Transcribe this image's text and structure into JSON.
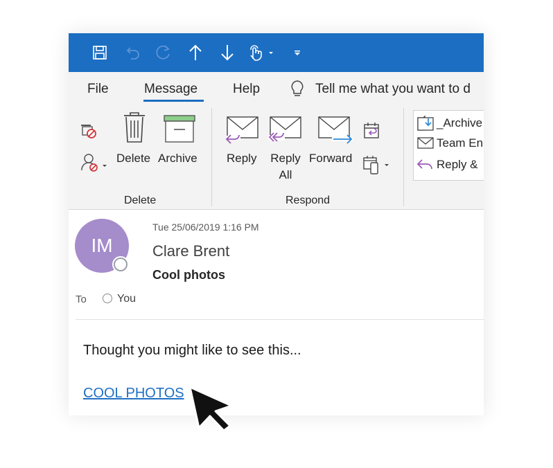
{
  "colors": {
    "titlebar": "#1b6ec2",
    "ribbon": "#f3f3f3",
    "avatar": "#a58ccb",
    "link": "#1f6fc5",
    "accent_purple": "#9b59b6"
  },
  "quick_access": [
    "save-icon",
    "undo-icon",
    "redo-icon",
    "previous-item-icon",
    "next-item-icon",
    "touch-mode-icon",
    "customize-qat-icon"
  ],
  "menu": {
    "file": "File",
    "message": "Message",
    "help": "Help",
    "tell_me": "Tell me what you want to d"
  },
  "ribbon": {
    "delete_group": {
      "delete_label": "Delete",
      "archive_label": "Archive",
      "group_label": "Delete"
    },
    "respond_group": {
      "reply_label": "Reply",
      "reply_all_line1": "Reply",
      "reply_all_line2": "All",
      "forward_label": "Forward",
      "group_label": "Respond"
    },
    "quick_steps": [
      "_Archive",
      "Team En",
      "Reply &"
    ]
  },
  "message": {
    "avatar_initials": "IM",
    "date": "Tue 25/06/2019 1:16 PM",
    "sender": "Clare Brent",
    "subject": "Cool photos",
    "to_label": "To",
    "recipient": "You",
    "body": "Thought you might like to see this...",
    "link_text": "COOL PHOTOS"
  }
}
